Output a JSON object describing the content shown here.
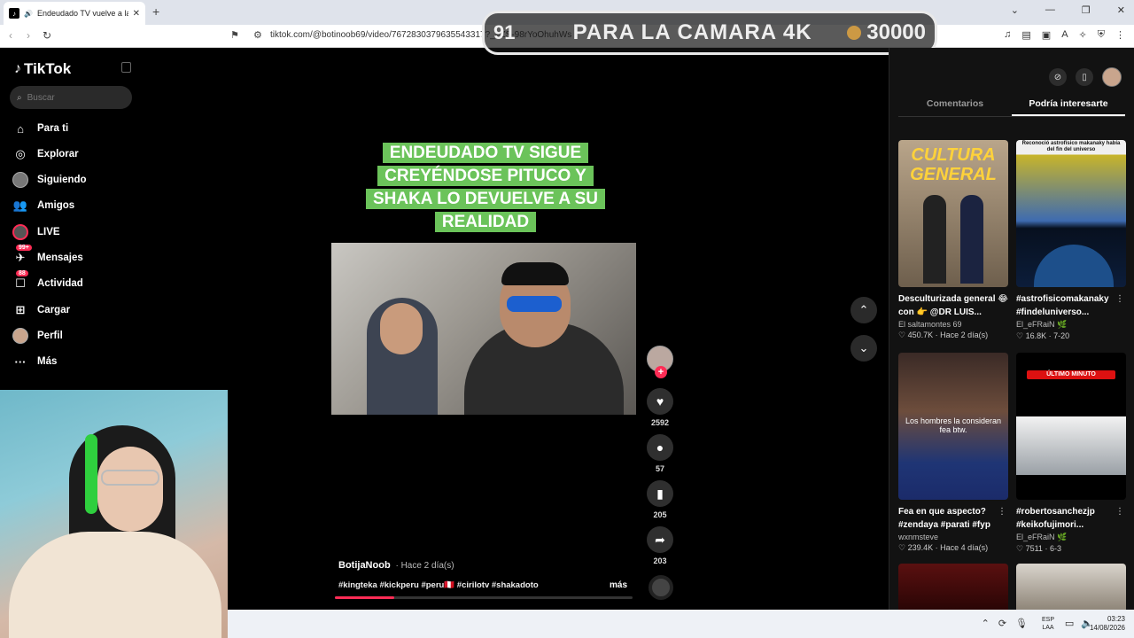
{
  "browser": {
    "tab_title": "Endeudado TV vuelve a la re",
    "url": "tiktok.com/@botinoob69/video/7672830379635543317?_=ZS-98rYoOhuhWs"
  },
  "overlay": {
    "left_number": "91",
    "text": "PARA LA CAMARA 4K",
    "goal": "30000"
  },
  "sidebar": {
    "logo": "TikTok",
    "search_placeholder": "Buscar",
    "items": [
      {
        "label": "Para ti",
        "icon": "home-icon"
      },
      {
        "label": "Explorar",
        "icon": "compass-icon"
      },
      {
        "label": "Siguiendo",
        "icon": "avatar-icon"
      },
      {
        "label": "Amigos",
        "icon": "friends-icon"
      },
      {
        "label": "LIVE",
        "icon": "live-icon"
      },
      {
        "label": "Mensajes",
        "icon": "message-icon",
        "badge": "99+"
      },
      {
        "label": "Actividad",
        "icon": "activity-icon",
        "badge": "88"
      },
      {
        "label": "Cargar",
        "icon": "upload-icon"
      },
      {
        "label": "Perfil",
        "icon": "profile-icon"
      },
      {
        "label": "Más",
        "icon": "more-icon"
      }
    ]
  },
  "video": {
    "caption": "ENDEUDADO TV SIGUE CREYÉNDOSE PITUCO Y SHAKA LO DEVUELVE A SU REALIDAD",
    "author": "BotijaNoob",
    "time": "Hace 2 día(s)",
    "hashtags": "#kingteka #kickperu #peru🇵🇪 #cirilotv #shakadoto",
    "more": "más",
    "progress": 0.2,
    "likes": "2592",
    "comments": "57",
    "saves": "205",
    "shares": "203"
  },
  "rightpanel": {
    "tabs": [
      "Comentarios",
      "Podría interesarte"
    ],
    "active_tab": 1,
    "cards": [
      {
        "thumb_text": "CULTURA GENERAL",
        "title": "Desculturizada general 😂 con 👉 @DR LUIS...",
        "author": "El saltamontes 69",
        "views": "450.7K",
        "time": "Hace 2 día(s)",
        "color": "#8a7a67"
      },
      {
        "thumb_text": "Reconoció astrofísico makanaky había del fin del universo",
        "title": "#astrofisicomakanaky #findeluniverso...",
        "author": "El_eFRaiN 🌿",
        "views": "16.8K",
        "time": "7-20",
        "color": "#1f3e6b"
      },
      {
        "thumb_text": "Los hombres la consideran fea btw.",
        "title": "Fea en que aspecto? #zendaya #parati #fyp",
        "author": "wxnmsteve",
        "views": "239.4K",
        "time": "Hace 4 día(s)",
        "color": "#2a3c7a"
      },
      {
        "thumb_text": "ÚLTIMO MINUTO",
        "title": "#robertosanchezjp #keikofujimori...",
        "author": "El_eFRaiN 🌿",
        "views": "7511",
        "time": "6-3",
        "color": "#f2f2f2"
      }
    ]
  },
  "taskbar": {
    "lang_top": "ESP",
    "lang_bottom": "LAA",
    "time": "03:23",
    "date": "14/08/2026"
  }
}
